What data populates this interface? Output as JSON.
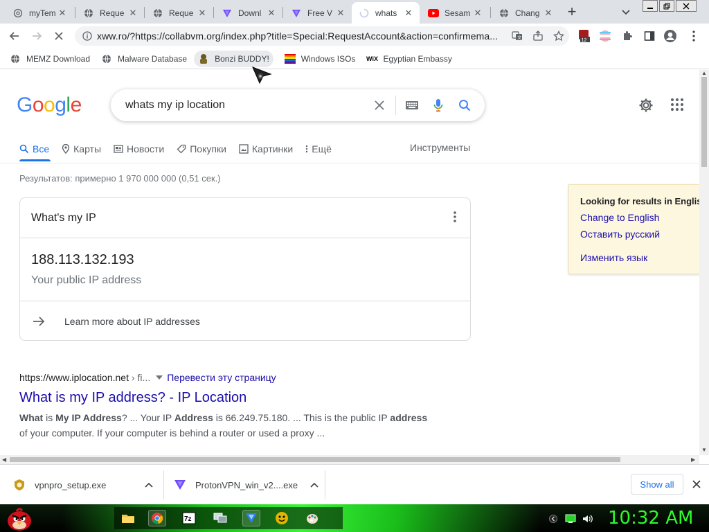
{
  "browser": {
    "tabs": [
      {
        "title": "myTem",
        "favicon": "at-icon"
      },
      {
        "title": "Reque",
        "favicon": "globe-icon"
      },
      {
        "title": "Reque",
        "favicon": "globe-icon"
      },
      {
        "title": "Downl",
        "favicon": "protonvpn-icon"
      },
      {
        "title": "Free V",
        "favicon": "protonvpn-icon"
      },
      {
        "title": "whats",
        "favicon": "loading-spinner-icon"
      },
      {
        "title": "Sesam",
        "favicon": "youtube-icon"
      },
      {
        "title": "Chang",
        "favicon": "globe-icon"
      }
    ],
    "active_tab_index": 5,
    "url": "xww.ro/?https://collabvm.org/index.php?title=Special:RequestAccount&action=confirmema...",
    "extension_badge": "12",
    "bookmarks": [
      {
        "label": "MEMZ Download",
        "icon": "globe-icon"
      },
      {
        "label": "Malware Database",
        "icon": "globe-icon"
      },
      {
        "label": "Bonzi BUDDY!",
        "icon": "bonzi-icon"
      },
      {
        "label": "Windows ISOs",
        "icon": "windows-flag-icon"
      },
      {
        "label": "Egyptian Embassy",
        "icon": "wix-icon"
      }
    ]
  },
  "google": {
    "logo": "Google",
    "query": "whats my ip location",
    "tabs": [
      "Все",
      "Карты",
      "Новости",
      "Покупки",
      "Картинки",
      "Ещё"
    ],
    "tools": "Инструменты",
    "stats": "Результатов: примерно 1 970 000 000 (0,51 сек.)",
    "ip_card": {
      "header": "What's my IP",
      "ip": "188.113.132.193",
      "subtitle": "Your public IP address",
      "learn_more": "Learn more about IP addresses"
    },
    "language_box": {
      "title": "Looking for results in English?",
      "change": "Change to English",
      "keep": "Оставить русский",
      "settings": "Изменить язык"
    },
    "result": {
      "site": "https://www.iplocation.net",
      "path": "› fi...",
      "translate": "Перевести эту страницу",
      "title": "What is my IP address? - IP Location",
      "snippet_line1_a": "What",
      "snippet_line1_b": " is ",
      "snippet_line1_c": "My IP Address",
      "snippet_line1_d": "? ... Your IP ",
      "snippet_line1_e": "Address",
      "snippet_line1_f": " is 66.249.75.180. ... This is the public IP ",
      "snippet_line1_g": "address",
      "snippet_line2": "of your computer. If your computer is behind a router or used a proxy ..."
    }
  },
  "downloads": {
    "items": [
      {
        "name": "vpnpro_setup.exe",
        "icon": "vpnpro-icon"
      },
      {
        "name": "ProtonVPN_win_v2....exe",
        "icon": "protonvpn-icon"
      }
    ],
    "show_all": "Show all"
  },
  "taskbar": {
    "clock": "10:32 AM",
    "start_icon": "angry-bird-icon",
    "apps": [
      "folder-icon",
      "chrome-icon",
      "7zip-icon",
      "network-icon",
      "protonvpn-icon",
      "bonzi-icon",
      "paint-icon"
    ]
  },
  "colors": {
    "google_blue": "#4285F4",
    "google_red": "#EA4335",
    "google_yellow": "#FBBC05",
    "google_green": "#34A853",
    "link": "#1a0dab",
    "active_tab_blue": "#1a73e8",
    "clock_green": "#2aff2a"
  }
}
